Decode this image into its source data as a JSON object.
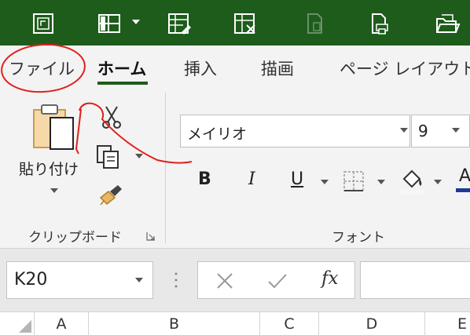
{
  "tabs": [
    "ファイル",
    "ホーム",
    "挿入",
    "描画",
    "ページ レイアウト"
  ],
  "active_tab": "ホーム",
  "clipboard": {
    "paste_label": "貼り付け",
    "group_label": "クリップボード"
  },
  "font": {
    "font_name": "メイリオ",
    "font_size": "9",
    "group_label": "フォント",
    "bold_label": "B",
    "italic_label": "I",
    "underline_label": "U",
    "font_color_label": "A"
  },
  "formula_bar": {
    "name_box_value": "K20",
    "fx_label": "fx",
    "formula_value": ""
  },
  "columns": [
    "A",
    "B",
    "C",
    "D",
    "E"
  ],
  "colors": {
    "title_bar": "#1e5c1c",
    "annotation": "#e0201b"
  }
}
